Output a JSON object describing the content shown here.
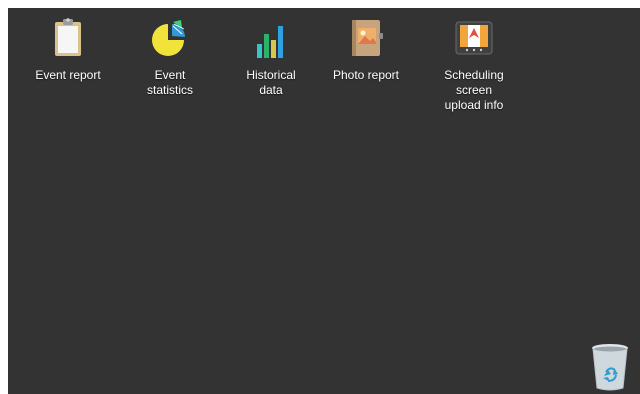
{
  "desktop": {
    "background_color": "#333333",
    "icons": [
      {
        "label": "Event report",
        "icon": "clipboard-icon"
      },
      {
        "label": "Event\nstatistics",
        "icon": "pie-chart-icon"
      },
      {
        "label": "Historical\ndata",
        "icon": "bar-chart-icon"
      },
      {
        "label": "Photo report",
        "icon": "photo-album-icon"
      },
      {
        "label": "Scheduling\nscreen\nupload info",
        "icon": "navigation-screen-icon"
      }
    ],
    "trash": {
      "icon": "recycle-bin-icon"
    }
  }
}
